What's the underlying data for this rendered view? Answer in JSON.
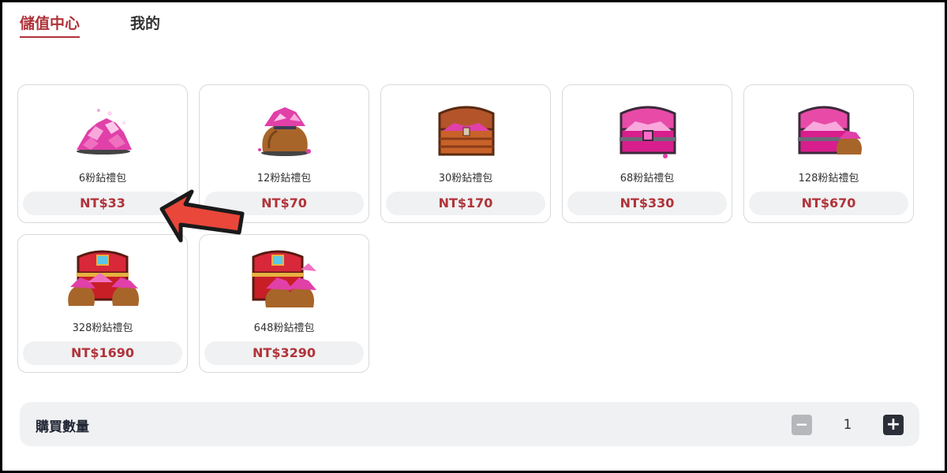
{
  "tabs": {
    "active": "儲值中心",
    "mine": "我的"
  },
  "packages": [
    {
      "name": "6粉鉆禮包",
      "price": "NT$33"
    },
    {
      "name": "12粉鉆禮包",
      "price": "NT$70"
    },
    {
      "name": "30粉鉆禮包",
      "price": "NT$170"
    },
    {
      "name": "68粉鉆禮包",
      "price": "NT$330"
    },
    {
      "name": "128粉鉆禮包",
      "price": "NT$670"
    },
    {
      "name": "328粉鉆禮包",
      "price": "NT$1690"
    },
    {
      "name": "648粉鉆禮包",
      "price": "NT$3290"
    }
  ],
  "quantity": {
    "label": "購買數量",
    "value": "1",
    "minus": "−",
    "plus": "+"
  },
  "colors": {
    "accent": "#b0333a",
    "panel": "#f0f1f3",
    "arrow": "#e8473a"
  }
}
